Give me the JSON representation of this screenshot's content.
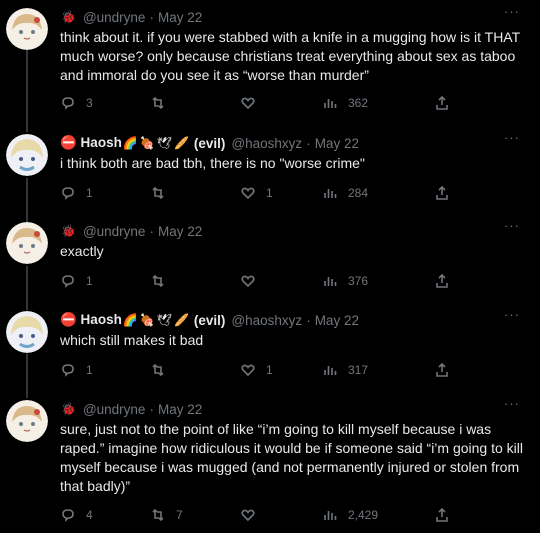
{
  "thread": [
    {
      "name": "",
      "emojis": [
        "🐞"
      ],
      "handle": "@undryne",
      "date": "May 22",
      "text": "think about it. if you were stabbed with a knife in a mugging how is it THAT much worse? only because christians treat everything about sex as taboo and immoral do you see it as “worse than murder”",
      "replies": "3",
      "retweets": "",
      "likes": "",
      "views": "362"
    },
    {
      "name": "⛔ Haosh",
      "emojis": [
        "🌈",
        "🍖",
        "🕊",
        "🥖"
      ],
      "suffix": "(evil)",
      "handle": "@haoshxyz",
      "date": "May 22",
      "text": "i think both are bad tbh, there is no \"worse crime\"",
      "replies": "1",
      "retweets": "",
      "likes": "1",
      "views": "284"
    },
    {
      "name": "",
      "emojis": [
        "🐞"
      ],
      "handle": "@undryne",
      "date": "May 22",
      "text": "exactly",
      "replies": "1",
      "retweets": "",
      "likes": "",
      "views": "376"
    },
    {
      "name": "⛔ Haosh",
      "emojis": [
        "🌈",
        "🍖",
        "🕊",
        "🥖"
      ],
      "suffix": "(evil)",
      "handle": "@haoshxyz",
      "date": "May 22",
      "text": "which still makes it bad",
      "replies": "1",
      "retweets": "",
      "likes": "1",
      "views": "317"
    },
    {
      "name": "",
      "emojis": [
        "🐞"
      ],
      "handle": "@undryne",
      "date": "May 22",
      "text": "sure, just not to the point of like “i’m going to kill myself because i was raped.” imagine how ridiculous it would be if someone said “i’m going to kill myself because i was mugged (and not permanently injured or stolen from that badly)”",
      "replies": "4",
      "retweets": "7",
      "likes": "",
      "views": "2,429"
    }
  ],
  "ui": {
    "more_label": "···",
    "separator": "·"
  }
}
